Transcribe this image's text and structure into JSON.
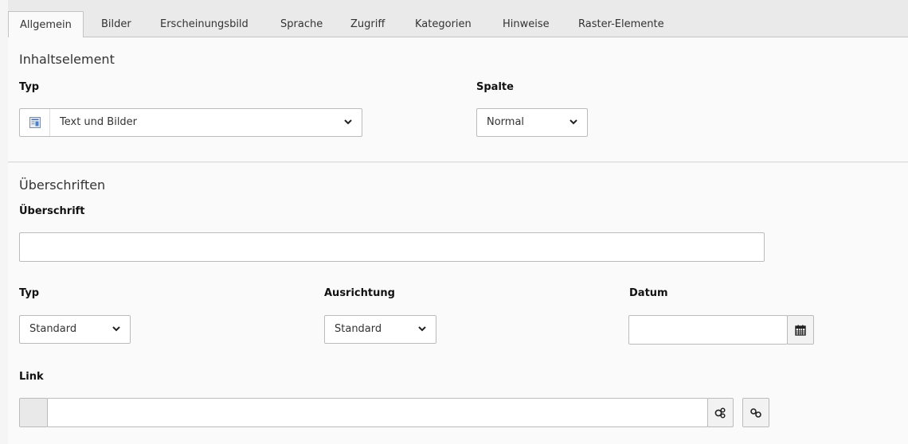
{
  "tabs": [
    {
      "label": "Allgemein",
      "active": true
    },
    {
      "label": "Bilder"
    },
    {
      "label": "Erscheinungsbild"
    },
    {
      "label": "Sprache"
    },
    {
      "label": "Zugriff"
    },
    {
      "label": "Kategorien"
    },
    {
      "label": "Hinweise"
    },
    {
      "label": "Raster-Elemente"
    }
  ],
  "content_element": {
    "title": "Inhaltselement",
    "type_label": "Typ",
    "type_value": "Text und Bilder",
    "type_icon": "content-text-image-icon",
    "column_label": "Spalte",
    "column_value": "Normal"
  },
  "headers": {
    "title": "Überschriften",
    "header_label": "Überschrift",
    "header_value": "",
    "type_label": "Typ",
    "type_value": "Standard",
    "alignment_label": "Ausrichtung",
    "alignment_value": "Standard",
    "date_label": "Datum",
    "date_value": "",
    "link_label": "Link",
    "link_value": ""
  },
  "icons": {
    "calendar": "calendar-icon",
    "link_browser": "link-browser-icon",
    "link": "link-icon"
  }
}
